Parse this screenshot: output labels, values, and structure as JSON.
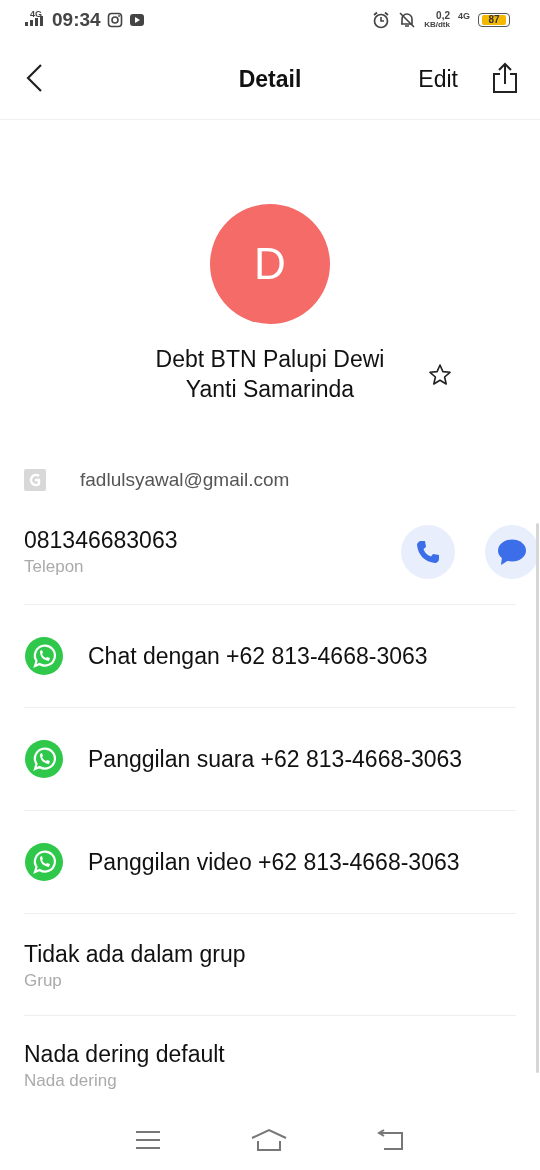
{
  "status_bar": {
    "network": "4G",
    "time": "09:34",
    "speed_value": "0,2",
    "speed_unit": "KB/dtk",
    "data_network": "4G",
    "battery": "87"
  },
  "header": {
    "title": "Detail",
    "edit": "Edit"
  },
  "contact": {
    "initial": "D",
    "name": "Debt BTN Palupi Dewi Yanti Samarinda",
    "starred": false
  },
  "account": {
    "email": "fadlulsyawal@gmail.com"
  },
  "phone": {
    "number": "081346683063",
    "label": "Telepon"
  },
  "whatsapp_actions": [
    {
      "label": "Chat dengan +62 813-4668-3063"
    },
    {
      "label": "Panggilan suara +62 813-4668-3063"
    },
    {
      "label": "Panggilan video +62 813-4668-3063"
    }
  ],
  "group": {
    "value": "Tidak ada dalam grup",
    "label": "Grup"
  },
  "ringtone": {
    "value": "Nada dering default",
    "label": "Nada dering"
  }
}
